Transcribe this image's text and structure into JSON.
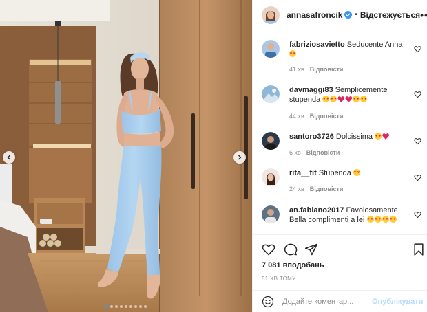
{
  "post": {
    "author": "annasafroncik",
    "verified": true,
    "separator": "•",
    "follow_status": "Відстежується",
    "more_label": "•••"
  },
  "comments": [
    {
      "user": "fabriziosavietto",
      "text": "Seducente Anna",
      "emojis": [
        "face-hearts"
      ],
      "time": "41 хв",
      "reply": "Відповісти"
    },
    {
      "user": "davmaggi83",
      "text": "Semplicemente stupenda",
      "emojis": [
        "face-hearts",
        "face-hearts",
        "heart",
        "heart",
        "face-hearts",
        "face-hearts"
      ],
      "time": "44 хв",
      "reply": "Відповісти"
    },
    {
      "user": "santoro3726",
      "text": "Dolcissima",
      "emojis": [
        "face-hearts",
        "heart"
      ],
      "time": "6 хв",
      "reply": "Відповісти"
    },
    {
      "user": "rita__fit",
      "text": "Stupenda",
      "emojis": [
        "face-hearts"
      ],
      "time": "24 хв",
      "reply": "Відповісти"
    },
    {
      "user": "an.fabiano2017",
      "text": "Favolosamente Bella complimenti a lei",
      "emojis": [
        "face-hearts",
        "face-hearts",
        "face-hearts",
        "face-hearts"
      ],
      "time": "",
      "reply": ""
    }
  ],
  "likes_text": "7 081 вподобань",
  "timestamp": "51 ХВ ТОМУ",
  "add_comment": {
    "placeholder": "Додайте коментар...",
    "publish_label": "Опублікувати"
  },
  "carousel": {
    "total_slides": 9,
    "current_slide": 1
  },
  "icons": [
    "chevron-left-icon",
    "chevron-right-icon",
    "verified-badge-icon",
    "heart-icon",
    "comment-icon",
    "share-icon",
    "bookmark-icon",
    "smiley-icon"
  ],
  "colors": {
    "accent": "#3897f0",
    "text": "#262626",
    "muted": "#8e8e8e",
    "publish_disabled": "#b3dbff",
    "outfit": "#a9cdee",
    "emoji_heart": "#e0245e"
  }
}
